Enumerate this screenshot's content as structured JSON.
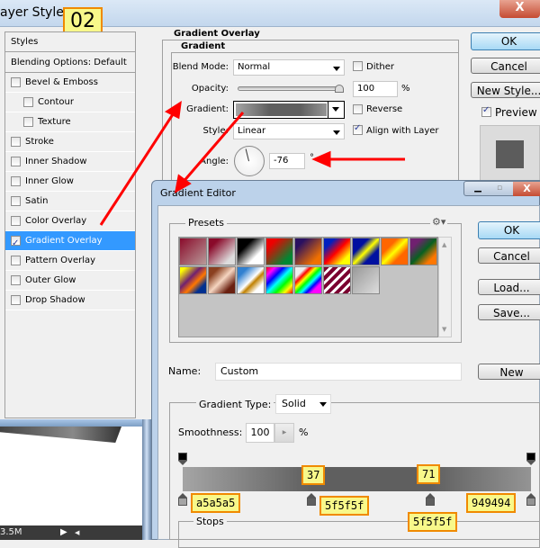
{
  "step_label": "02",
  "layer_style": {
    "title": "ayer Style",
    "close_label": "X",
    "styles_header": "Styles",
    "blending_options": "Blending Options: Default",
    "items": [
      {
        "label": "Bevel & Emboss",
        "checked": false,
        "indent": false
      },
      {
        "label": "Contour",
        "checked": false,
        "indent": true
      },
      {
        "label": "Texture",
        "checked": false,
        "indent": true
      },
      {
        "label": "Stroke",
        "checked": false,
        "indent": false
      },
      {
        "label": "Inner Shadow",
        "checked": false,
        "indent": false
      },
      {
        "label": "Inner Glow",
        "checked": false,
        "indent": false
      },
      {
        "label": "Satin",
        "checked": false,
        "indent": false
      },
      {
        "label": "Color Overlay",
        "checked": false,
        "indent": false
      },
      {
        "label": "Gradient Overlay",
        "checked": true,
        "indent": false,
        "selected": true
      },
      {
        "label": "Pattern Overlay",
        "checked": false,
        "indent": false
      },
      {
        "label": "Outer Glow",
        "checked": false,
        "indent": false
      },
      {
        "label": "Drop Shadow",
        "checked": false,
        "indent": false
      }
    ],
    "group_title": "Gradient Overlay",
    "subgroup_title": "Gradient",
    "blend_mode_label": "Blend Mode:",
    "blend_mode_value": "Normal",
    "dither_label": "Dither",
    "opacity_label": "Opacity:",
    "opacity_value": "100",
    "opacity_unit": "%",
    "opacity_fraction": 1.0,
    "gradient_label": "Gradient:",
    "reverse_label": "Reverse",
    "style_label": "Style:",
    "style_value": "Linear",
    "align_label": "Align with Layer",
    "align_checked": true,
    "angle_label": "Angle:",
    "angle_value": "-76",
    "angle_unit": "°",
    "ok_label": "OK",
    "cancel_label": "Cancel",
    "new_style_label": "New Style...",
    "preview_label": "Preview",
    "preview_checked": true
  },
  "status_bar": {
    "doc_size": "3.5M"
  },
  "gradient_editor": {
    "title": "Gradient Editor",
    "presets_label": "Presets",
    "ok_label": "OK",
    "cancel_label": "Cancel",
    "load_label": "Load...",
    "save_label": "Save...",
    "name_label": "Name:",
    "name_value": "Custom",
    "new_label": "New",
    "gradient_type_label": "Gradient Type:",
    "gradient_type_value": "Solid",
    "smoothness_label": "Smoothness:",
    "smoothness_value": "100",
    "smoothness_unit": "%",
    "stops_label": "Stops",
    "presets": [
      "linear-gradient(135deg,#8a0a2a,#b89a9a)",
      "linear-gradient(135deg,#8a0a2a 20%,#ddd 80%)",
      "linear-gradient(135deg,#000 30%,#fff 70%)",
      "linear-gradient(135deg,#e00 20%,#083 80%)",
      "linear-gradient(135deg,#2a1060 20%,#f07000 80%)",
      "linear-gradient(135deg,#0020c0 20%,#f00 50%,#ff0 80%)",
      "linear-gradient(135deg,#0010a0 30%,#ff0 50%,#0010a0 70%)",
      "linear-gradient(135deg,#f60 30%,#ff0 50%,#f60 70%)",
      "linear-gradient(135deg,#702070 20%,#086020 50%,#f70 80%)",
      "linear-gradient(135deg,#ff0 10%,#702070 40%,#f70 60%,#003090 80%)",
      "linear-gradient(135deg,#8a4020 20%,#f5d5c0 50%,#6a2010 80%)",
      "linear-gradient(135deg,#3080d0 20%,#fff 50%,#c08000 60%,#fff 80%)",
      "linear-gradient(135deg,#f00,#f0f,#00f,#0ff,#0f0,#ff0,#f00)",
      "linear-gradient(135deg,#eee 20%,#f00,#ff0,#0f0,#0ff,#00f,#f0f 80%)",
      "repeating-linear-gradient(135deg,#7a0030 0 4px,#fff 4px 7px)",
      "linear-gradient(135deg,#999,#ddd)"
    ],
    "gradient_bar": {
      "stops": [
        {
          "location": 0,
          "color": "#a5a5a5"
        },
        {
          "location": 37,
          "color": "#5f5f5f"
        },
        {
          "location": 71,
          "color": "#5f5f5f"
        },
        {
          "location": 100,
          "color": "#949494"
        }
      ]
    },
    "annotations": {
      "loc_37": "37",
      "loc_71": "71",
      "color_0": "a5a5a5",
      "color_37": "5f5f5f",
      "color_71": "5f5f5f",
      "color_100": "949494"
    }
  }
}
